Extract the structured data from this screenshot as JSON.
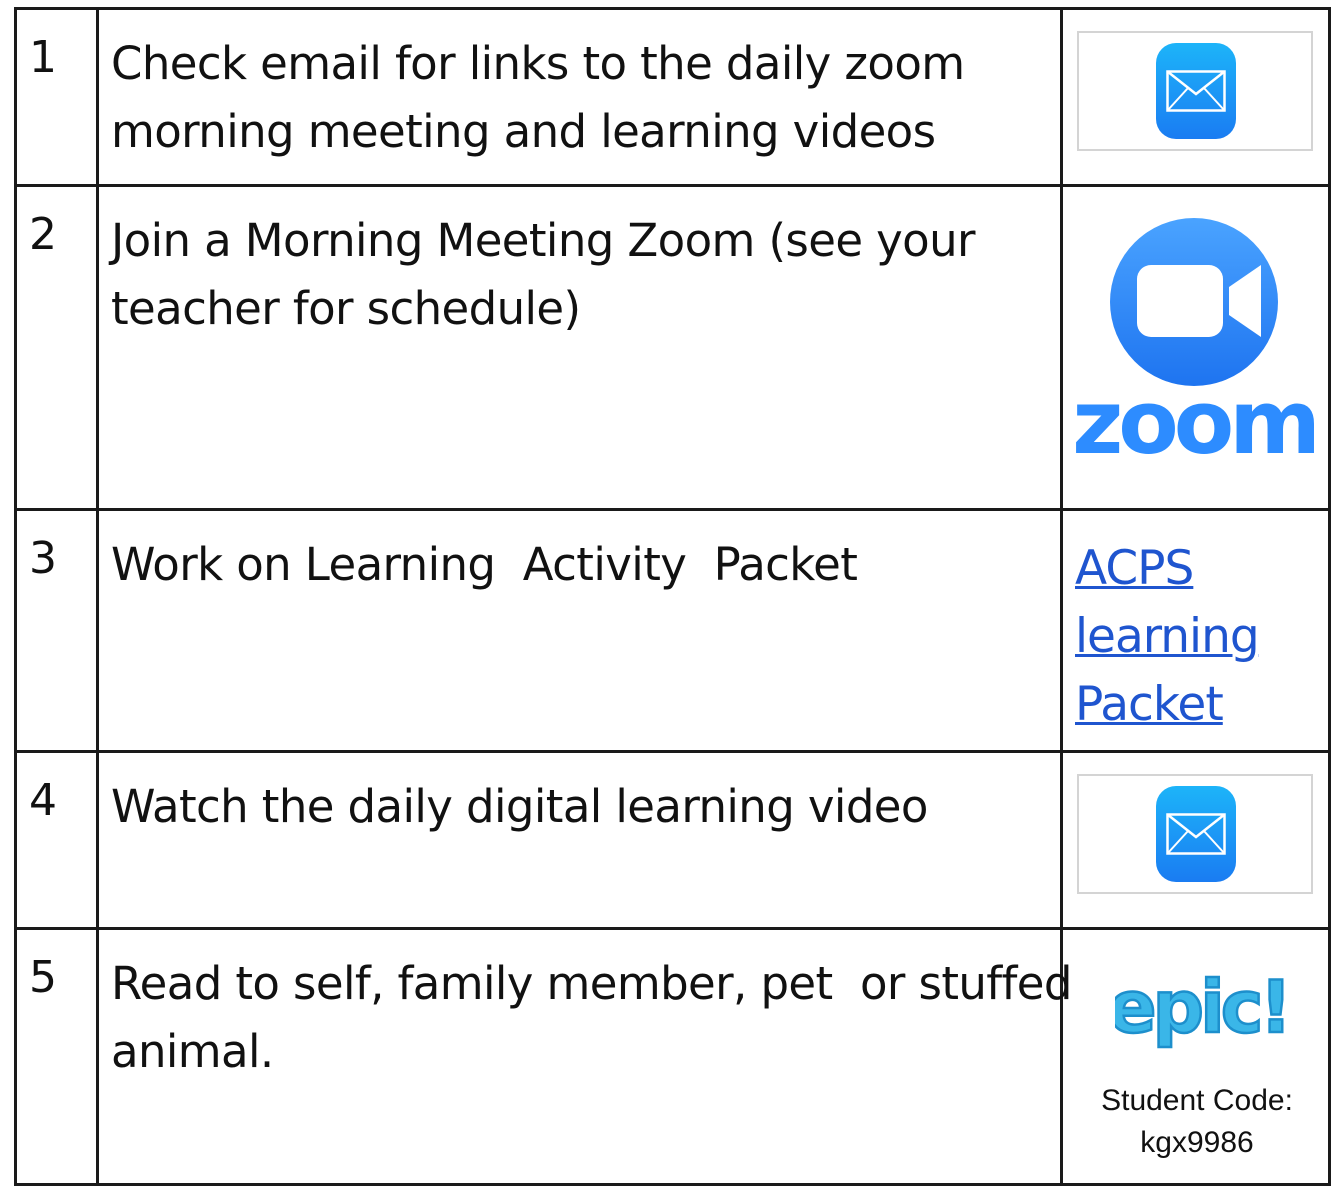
{
  "rows": [
    {
      "number": "1",
      "task_line1": "Check email for links to the daily zoom",
      "task_line2": "morning meeting and learning videos",
      "resource_icon": "mail-icon"
    },
    {
      "number": "2",
      "task_line1": "Join a Morning Meeting Zoom (see your",
      "task_line2": "teacher for schedule)",
      "resource_icon": "zoom-logo",
      "resource_logo_text": "zoom"
    },
    {
      "number": "3",
      "task_line1": "Work on Learning  Activity  Packet",
      "resource_link_line1": "ACPS",
      "resource_link_line2": "learning",
      "resource_link_line3": "Packet"
    },
    {
      "number": "4",
      "task_line1": "Watch the daily digital learning video",
      "resource_icon": "mail-icon"
    },
    {
      "number": "5",
      "task_line1": "Read to self, family member, pet  or stuffed",
      "task_line2": "animal.",
      "resource_icon": "epic-logo",
      "resource_logo_text": "epic!",
      "code_label": "Student Code:",
      "code_value": "kgx9986"
    }
  ],
  "colors": {
    "border": "#1a1a1a",
    "link": "#1f55cf",
    "mail_gradient_top": "#1db4f9",
    "mail_gradient_bottom": "#1a7cf2",
    "zoom_blue": "#2d8cff",
    "epic_blue": "#3ab6e8"
  }
}
